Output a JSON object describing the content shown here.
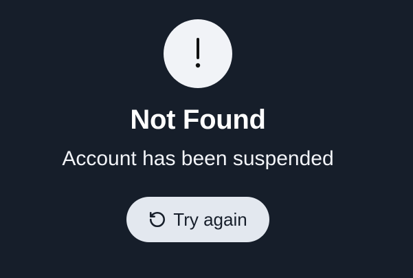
{
  "error": {
    "icon": "exclamation-icon",
    "title": "Not Found",
    "message": "Account has been suspended"
  },
  "actions": {
    "retry_icon": "refresh-icon",
    "retry_label": "Try again"
  },
  "colors": {
    "background": "#161e2a",
    "icon_circle": "#f1f3f7",
    "title_text": "#ffffff",
    "button_background": "#e3e8ef",
    "button_text": "#161e2a"
  }
}
